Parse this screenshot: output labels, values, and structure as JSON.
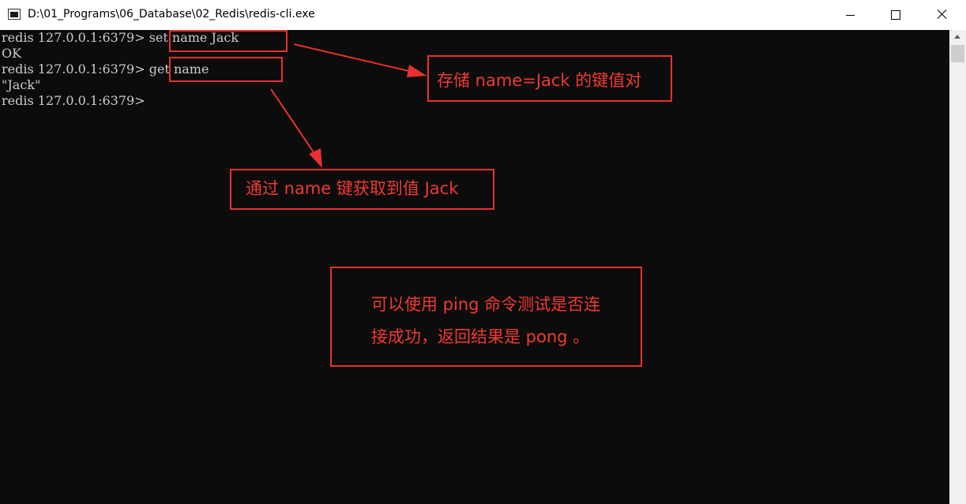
{
  "window": {
    "title": "D:\\01_Programs\\06_Database\\02_Redis\\redis-cli.exe",
    "icon": "console-app-icon",
    "controls": [
      "minimize-icon",
      "maximize-icon",
      "close-icon"
    ]
  },
  "console": {
    "lines": [
      {
        "prompt": "redis 127.0.0.1:6379>",
        "command": " set name Jack"
      },
      {
        "output": "OK"
      },
      {
        "prompt": "redis 127.0.0.1:6379>",
        "command": " get name"
      },
      {
        "output": "\"Jack\""
      },
      {
        "prompt": "redis 127.0.0.1:6379>",
        "command": ""
      }
    ]
  },
  "annotations": {
    "store_note": "存储 name=Jack 的键值对",
    "get_note": "通过 name 键获取到值  Jack",
    "ping_note_line1": "可以使用 ping 命令测试是否连",
    "ping_note_line2": "接成功，返回结果是 pong 。"
  },
  "colors": {
    "console_bg": "#0c0c0c",
    "console_text": "#cccccc",
    "annotation_red": "#e8312f"
  }
}
